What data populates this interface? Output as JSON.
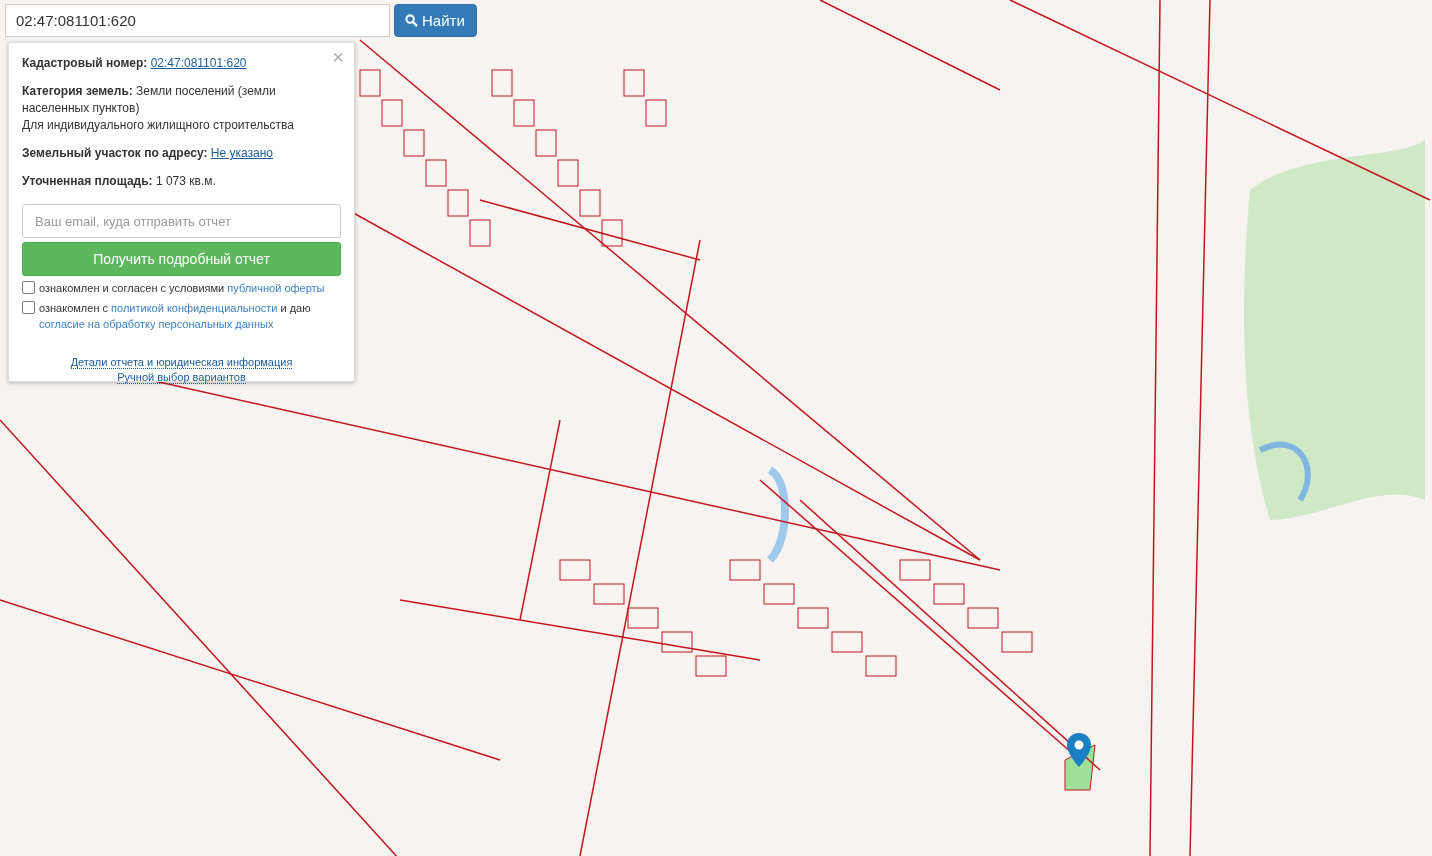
{
  "search": {
    "value": "02:47:081101:620",
    "button": "Найти"
  },
  "info_panel": {
    "close": "×",
    "cadastral": {
      "label": "Кадастровый номер:",
      "link": "02:47:081101:620"
    },
    "category": {
      "text": "**Категория земель:** Земли поселений (земли населенных пунктов)",
      "purpose": "Для индивидуального жилищного строительства"
    },
    "address": {
      "label": "Земельный участок по адресу:",
      "link": "Не указано"
    },
    "area": {
      "text": "**Уточненная площадь:** 1 073 кв.м."
    },
    "email": {
      "placeholder": "Ваш email, куда отправить отчет"
    },
    "submit": "Получить подробный отчет",
    "consents": [
      {
        "checked": false,
        "before": "ознакомлен и согласен с условиями ",
        "link": "публичной оферты"
      },
      {
        "checked": false,
        "before": "ознакомлен с ",
        "link": "политикой конфиденциальности",
        "after": " и даю ",
        "link2": "согласие на обработку персональных данных"
      }
    ],
    "footer_links": [
      "Детали отчета и юридическая информация",
      "Ручной выбор вариантов"
    ]
  }
}
